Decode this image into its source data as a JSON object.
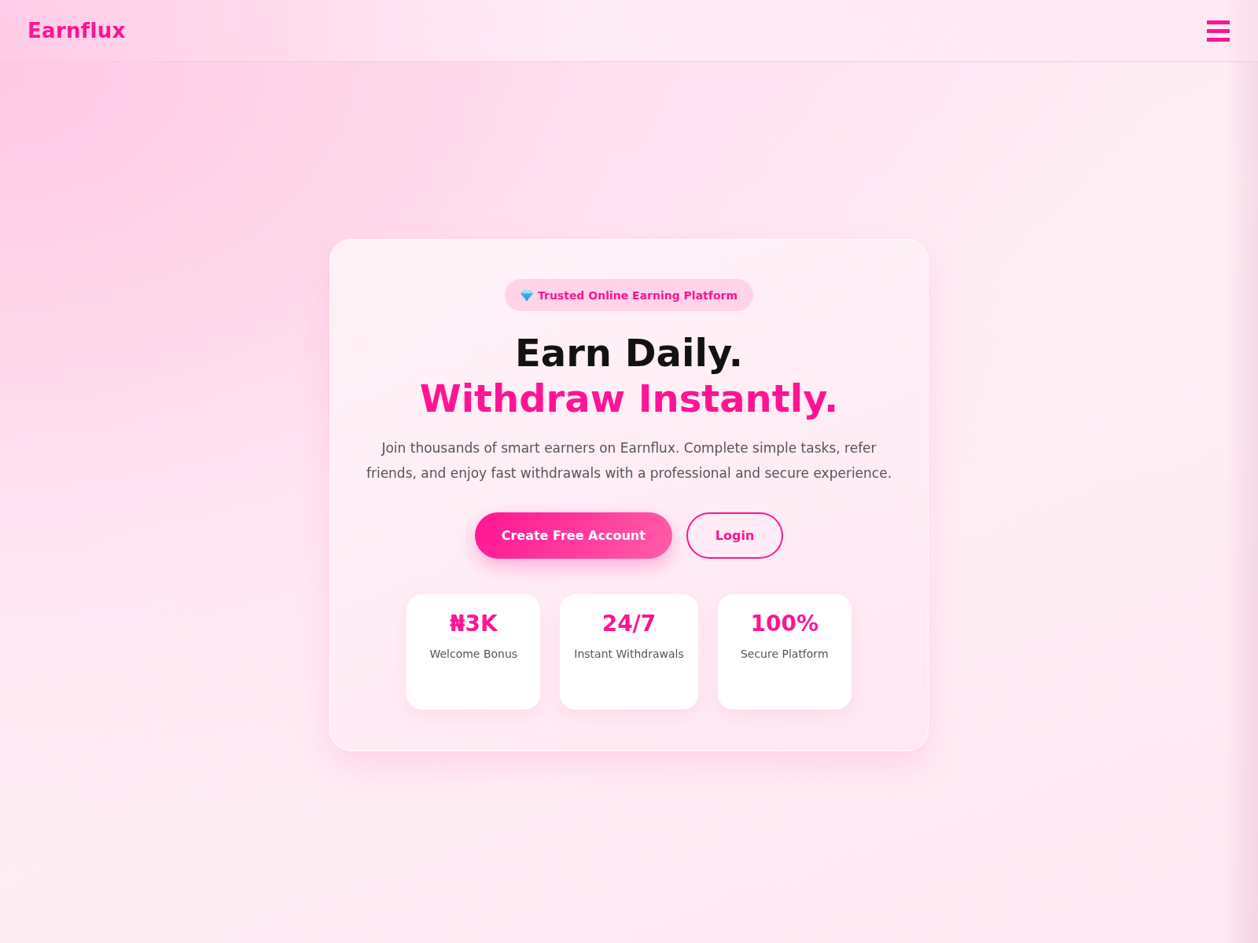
{
  "header": {
    "logo": "Earnflux"
  },
  "hero": {
    "badge": "Trusted Online Earning Platform",
    "title_line_1": "Earn Daily.",
    "title_line_2": "Withdraw Instantly.",
    "description": "Join thousands of smart earners on Earnflux. Complete simple tasks, refer friends, and enjoy fast withdrawals with a professional and secure experience.",
    "buttons": [
      {
        "label": "Create Free Account",
        "kind": "primary"
      },
      {
        "label": "Login",
        "kind": "outline"
      }
    ],
    "stats": [
      {
        "value": "₦3K",
        "label": "Welcome Bonus"
      },
      {
        "value": "24/7",
        "label": "Instant Withdrawals"
      },
      {
        "value": "100%",
        "label": "Secure Platform"
      }
    ]
  }
}
